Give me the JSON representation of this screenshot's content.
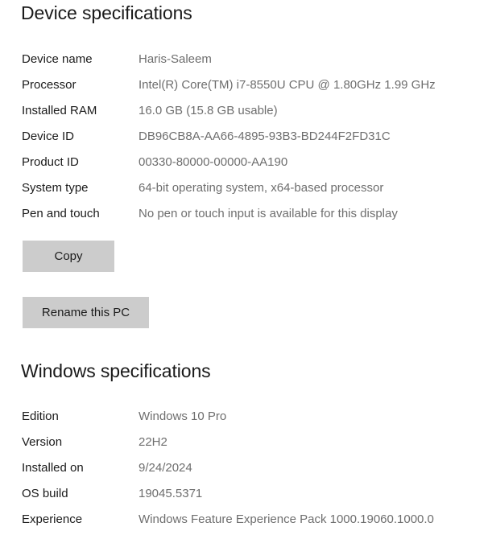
{
  "device_specifications": {
    "heading": "Device specifications",
    "rows": [
      {
        "label": "Device name",
        "value": "Haris-Saleem"
      },
      {
        "label": "Processor",
        "value": "Intel(R) Core(TM) i7-8550U CPU @ 1.80GHz   1.99 GHz"
      },
      {
        "label": "Installed RAM",
        "value": "16.0 GB (15.8 GB usable)"
      },
      {
        "label": "Device ID",
        "value": "DB96CB8A-AA66-4895-93B3-BD244F2FD31C"
      },
      {
        "label": "Product ID",
        "value": "00330-80000-00000-AA190"
      },
      {
        "label": "System type",
        "value": "64-bit operating system, x64-based processor"
      },
      {
        "label": "Pen and touch",
        "value": "No pen or touch input is available for this display"
      }
    ],
    "copy_button_label": "Copy",
    "rename_button_label": "Rename this PC"
  },
  "windows_specifications": {
    "heading": "Windows specifications",
    "rows": [
      {
        "label": "Edition",
        "value": "Windows 10 Pro"
      },
      {
        "label": "Version",
        "value": "22H2"
      },
      {
        "label": "Installed on",
        "value": "9/24/2024"
      },
      {
        "label": "OS build",
        "value": "19045.5371"
      },
      {
        "label": "Experience",
        "value": "Windows Feature Experience Pack 1000.19060.1000.0"
      }
    ]
  },
  "colors": {
    "background": "#ffffff",
    "heading_text": "#1a1a1a",
    "label_text": "#1b1b1b",
    "value_text": "#6e6e6e",
    "button_fill": "#cccccc"
  }
}
